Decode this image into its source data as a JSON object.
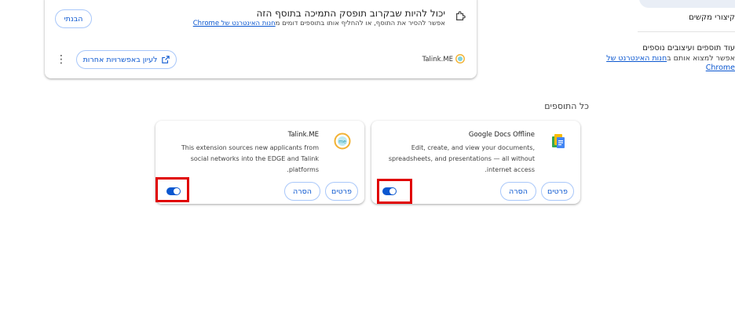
{
  "warning_card": {
    "title": "יכול להיות שבקרוב תופסק התמיכה בתוסף הזה",
    "subtitle_text": "אפשר להסיר את התוסף, או להחליף אותו בתוספים דומים מ",
    "subtitle_link": "חנות האינטרנט של Chrome",
    "understood_label": "הבנתי",
    "more_options_label": "לעיון באפשרויות אחרות",
    "extension_name": "Talink.ME"
  },
  "sidebar": {
    "shortcuts_label": "קיצורי מקשים",
    "more_title": "עוד תוספים ועיצובים נוספים",
    "more_sub_text": "אפשר למצוא אותם ב",
    "more_sub_link": "חנות האינטרנט של",
    "more_sub_link2": "Chrome"
  },
  "section_title": "כל התוספים",
  "extensions": [
    {
      "name": "Talink.ME",
      "description": "This extension sources new applicants from social networks into the EDGE and Talink platforms.",
      "details_label": "פרטים",
      "remove_label": "הסרה",
      "enabled": true
    },
    {
      "name": "Google Docs Offline",
      "description": "Edit, create, and view your documents, spreadsheets, and presentations — all without internet access.",
      "details_label": "פרטים",
      "remove_label": "הסרה",
      "enabled": true
    }
  ],
  "colors": {
    "accent": "#0b57d0",
    "highlight": "#e00000"
  }
}
